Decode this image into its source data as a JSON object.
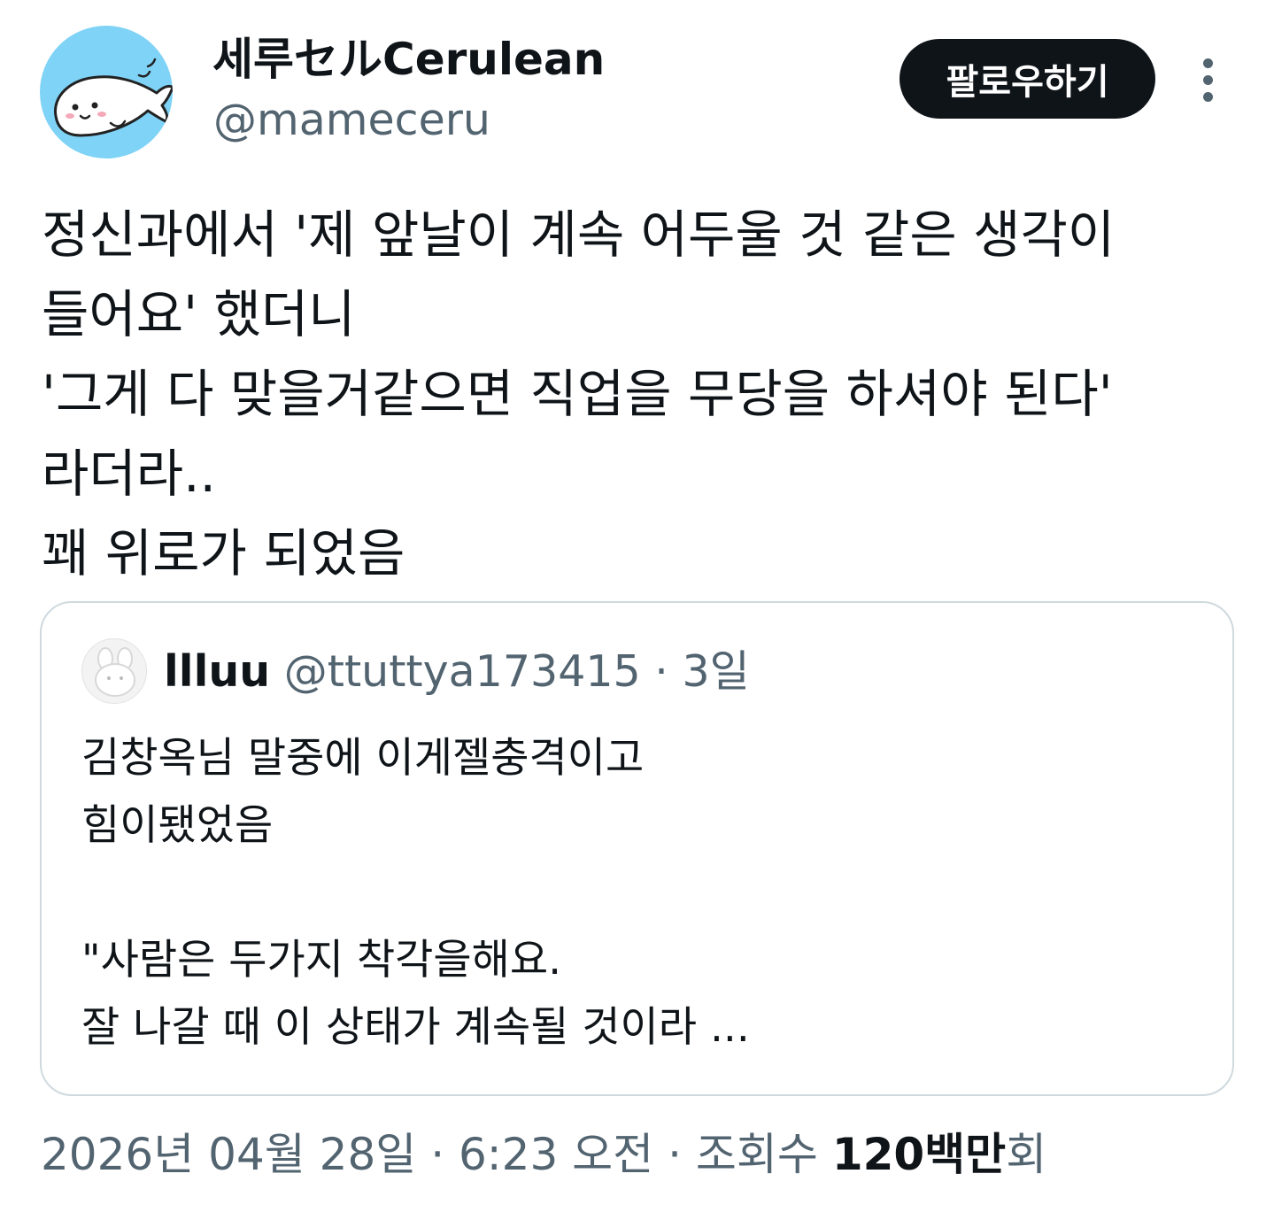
{
  "author": {
    "display_name": "세루セルCerulean",
    "handle": "@mameceru",
    "avatar_icon": "seal-avatar-icon",
    "avatar_color": "#7fd3f7"
  },
  "actions": {
    "follow_label": "팔로우하기",
    "more_icon": "more-vertical-icon"
  },
  "tweet": {
    "lines": [
      "정신과에서 '제 앞날이 계속 어두울 것 같은 생각이",
      "들어요' 했더니",
      "'그게 다 맞을거같으면 직업을 무당을 하셔야 된다'",
      "라더라..",
      "꽤 위로가 되었음"
    ]
  },
  "quote": {
    "name": "llluu",
    "handle": "@ttuttya173415",
    "separator": "·",
    "time": "3일",
    "lines": [
      "김창옥님 말중에 이게젤충격이고",
      "힘이됐었음",
      "",
      "\"사람은 두가지 착각을해요.",
      "잘 나갈 때 이 상태가 계속될 것이라 ..."
    ]
  },
  "meta": {
    "date": "2026년 04월 28일",
    "sep1": "·",
    "time": "6:23 오전",
    "sep2": "·",
    "views_label": "조회수",
    "views_count": "120백만",
    "views_suffix": "회"
  }
}
